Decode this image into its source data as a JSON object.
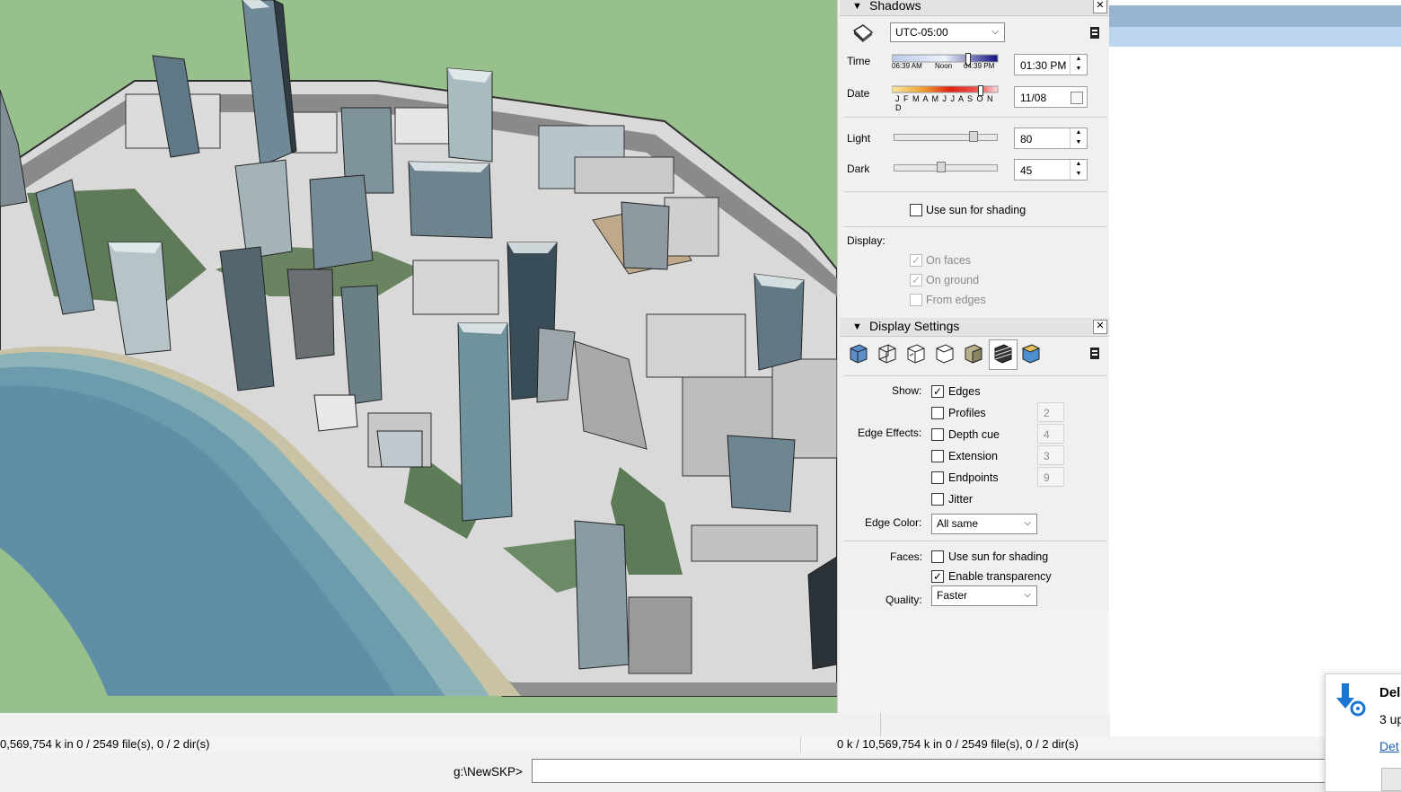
{
  "shadows": {
    "title": "Shadows",
    "timezone": "UTC-05:00",
    "time_label": "Time",
    "time_scale": {
      "start": "06:39 AM",
      "mid": "Noon",
      "end": "04:39 PM"
    },
    "time_value": "01:30 PM",
    "time_fraction": 0.72,
    "date_label": "Date",
    "months_scale": "J F M A M J J A S O N D",
    "date_value": "11/08",
    "date_fraction": 0.84,
    "light_label": "Light",
    "light_value": "80",
    "dark_label": "Dark",
    "dark_value": "45",
    "use_sun_label": "Use sun for shading",
    "use_sun_checked": false,
    "display_label": "Display:",
    "on_faces": "On faces",
    "on_ground": "On ground",
    "from_edges": "From edges"
  },
  "display_settings": {
    "title": "Display Settings",
    "styles": [
      "xray-style-icon",
      "wireframe-style-icon",
      "hidden-line-style-icon",
      "shaded-style-icon",
      "shaded-textures-style-icon",
      "monochrome-style-icon",
      "color-by-layer-style-icon"
    ],
    "show_label": "Show:",
    "edge_effects_label": "Edge Effects:",
    "edges": "Edges",
    "profiles": "Profiles",
    "profiles_value": "2",
    "depth_cue": "Depth cue",
    "depth_cue_value": "4",
    "extension": "Extension",
    "extension_value": "3",
    "endpoints": "Endpoints",
    "endpoints_value": "9",
    "jitter": "Jitter",
    "edge_color_label": "Edge Color:",
    "edge_color_value": "All same",
    "faces_label": "Faces:",
    "faces_use_sun": "Use sun for shading",
    "enable_transparency": "Enable transparency",
    "quality_label": "Quality:",
    "quality_value": "Faster"
  },
  "status": {
    "left_text": "0,569,754 k in 0 / 2549 file(s), 0 / 2 dir(s)",
    "right_text": "0 k / 10,569,754 k in 0 / 2549 file(s), 0 / 2 dir(s)",
    "path_label": "g:\\NewSKP>",
    "path_value": ""
  },
  "notification": {
    "title": "Del",
    "line": "3 up",
    "link": "Det"
  },
  "colors": {
    "ground": "#98c08c",
    "water": "#5f8fa6",
    "sand": "#c9c2a4",
    "panel": "#f0f0f0",
    "header": "#e3e3e3",
    "title_bar": "#99b4d1"
  }
}
